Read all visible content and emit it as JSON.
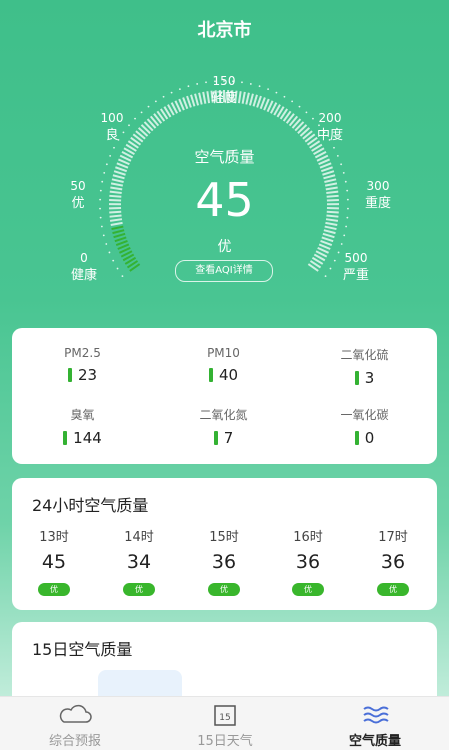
{
  "city": "北京市",
  "gauge": {
    "title": "空气质量",
    "value": "45",
    "level": "优",
    "details_button": "查看AQI详情",
    "aqi": 45,
    "max": 500,
    "scale": [
      {
        "num": "0",
        "label": "健康"
      },
      {
        "num": "50",
        "label": "优"
      },
      {
        "num": "100",
        "label": "良"
      },
      {
        "num": "150",
        "label": "轻度"
      },
      {
        "num": "200",
        "label": "中度"
      },
      {
        "num": "300",
        "label": "重度"
      },
      {
        "num": "500",
        "label": "严重"
      }
    ]
  },
  "pollutants": [
    {
      "name": "PM2.5",
      "value": "23"
    },
    {
      "name": "PM10",
      "value": "40"
    },
    {
      "name": "二氧化硫",
      "value": "3"
    },
    {
      "name": "臭氧",
      "value": "144"
    },
    {
      "name": "二氧化氮",
      "value": "7"
    },
    {
      "name": "一氧化碳",
      "value": "0"
    }
  ],
  "hourly": {
    "title": "24小时空气质量",
    "items": [
      {
        "time": "13时",
        "value": "45",
        "level": "优"
      },
      {
        "time": "14时",
        "value": "34",
        "level": "优"
      },
      {
        "time": "15时",
        "value": "36",
        "level": "优"
      },
      {
        "time": "16时",
        "value": "36",
        "level": "优"
      },
      {
        "time": "17时",
        "value": "36",
        "level": "优"
      }
    ]
  },
  "daily": {
    "title": "15日空气质量"
  },
  "tabs": [
    {
      "label": "综合预报",
      "icon": "cloud-icon"
    },
    {
      "label": "15日天气",
      "icon": "calendar-icon"
    },
    {
      "label": "空气质量",
      "icon": "wind-waves-icon"
    }
  ],
  "colors": {
    "accent": "#3fbf8a",
    "good_green": "#34b233",
    "active_tab_icon": "#4a6fd8"
  }
}
